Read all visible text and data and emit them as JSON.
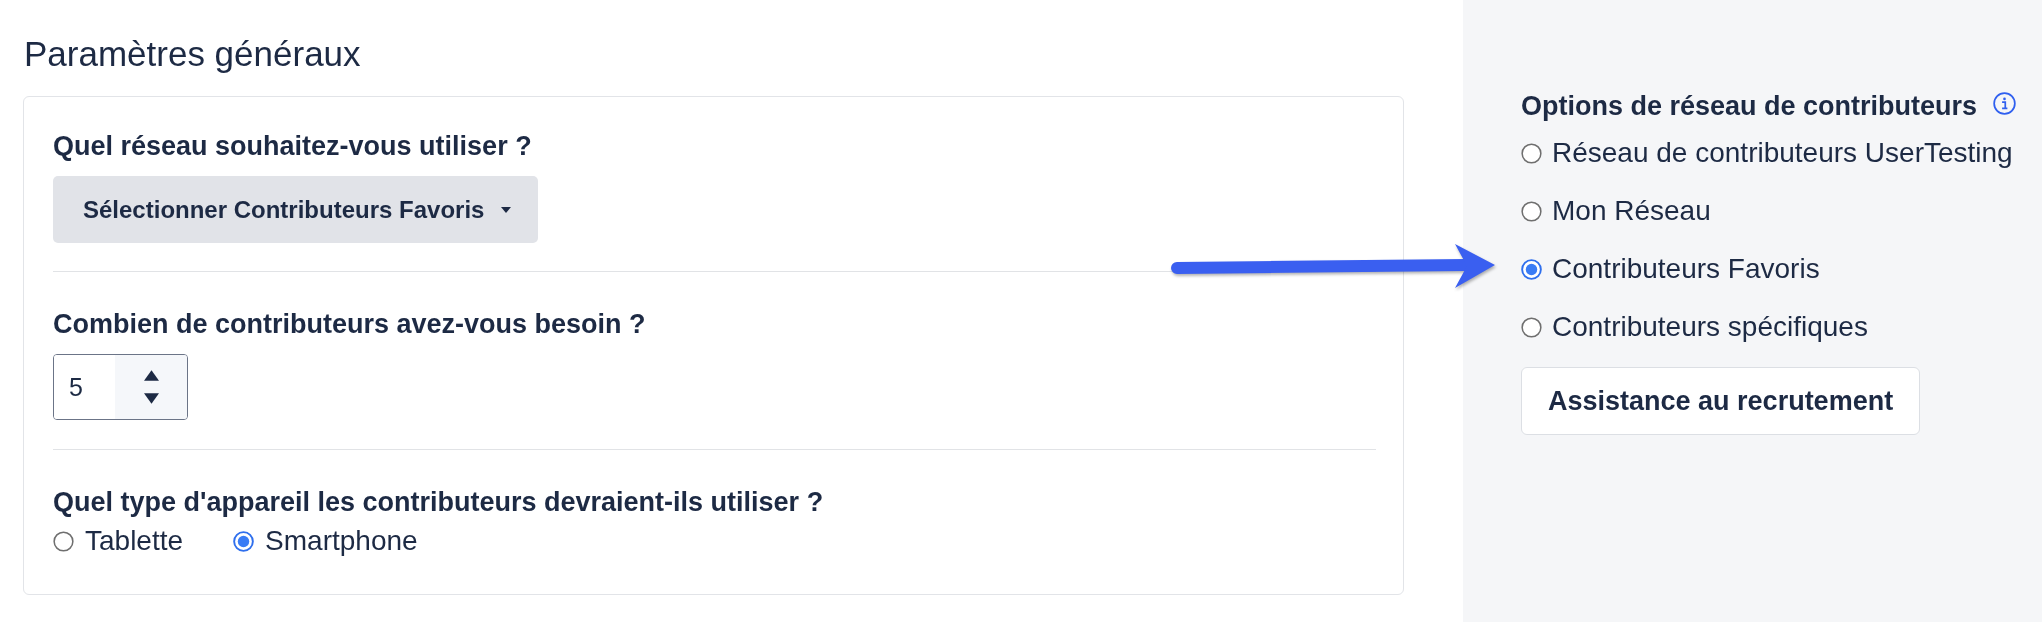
{
  "section_title": "Paramètres généraux",
  "settings": [
    {
      "kind": "dropdown",
      "question": "Quel réseau souhaitez-vous utiliser ?",
      "value": "Sélectionner Contributeurs Favoris"
    },
    {
      "kind": "number",
      "question": "Combien de contributeurs avez-vous besoin ?",
      "value": "5"
    },
    {
      "kind": "radios",
      "question": "Quel type d'appareil les contributeurs devraient-ils utiliser ?",
      "options": [
        {
          "label": "Tablette",
          "selected": false
        },
        {
          "label": "Smartphone",
          "selected": true
        }
      ]
    }
  ],
  "network_panel": {
    "title": "Options de réseau de contributeurs",
    "options": [
      {
        "label": "Réseau de contributeurs UserTesting",
        "selected": false
      },
      {
        "label": "Mon Réseau",
        "selected": false
      },
      {
        "label": "Contributeurs Favoris",
        "selected": true
      },
      {
        "label": "Contributeurs spécifiques",
        "selected": false
      }
    ],
    "button": "Assistance au recrutement"
  }
}
